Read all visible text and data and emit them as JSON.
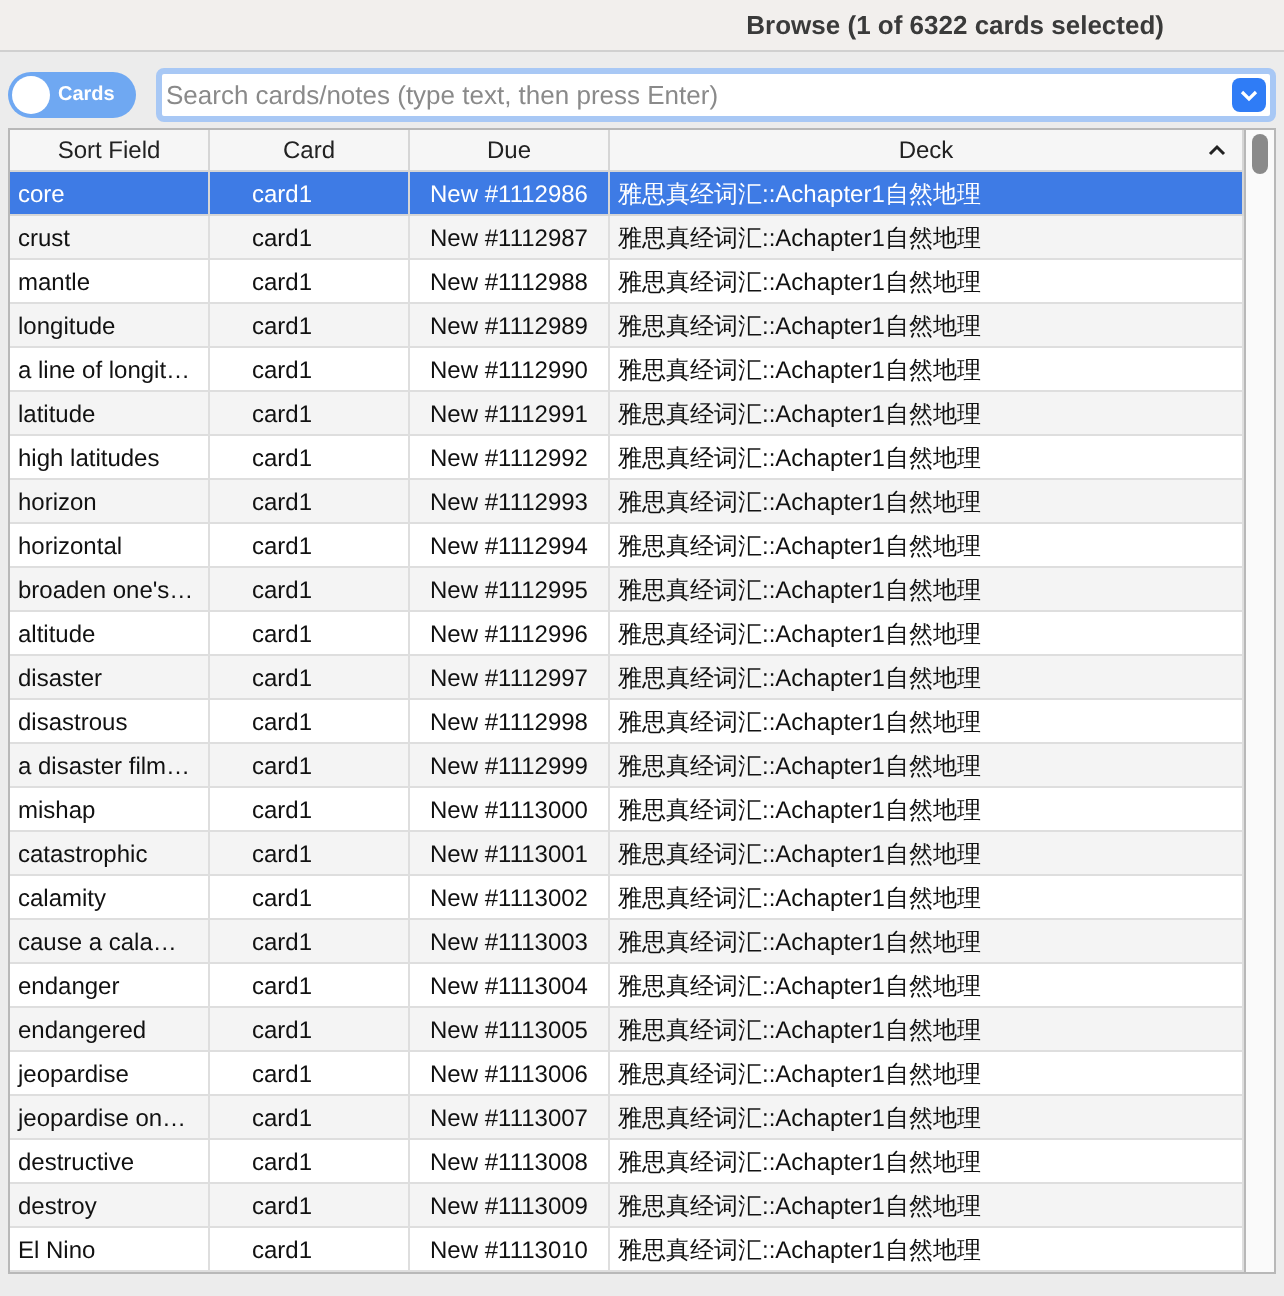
{
  "window": {
    "title": "Browse (1 of 6322 cards selected)"
  },
  "toggle": {
    "label": "Cards"
  },
  "search": {
    "placeholder": "Search cards/notes (type text, then press Enter)"
  },
  "table": {
    "columns": [
      {
        "label": "Sort Field",
        "sorted": false
      },
      {
        "label": "Card",
        "sorted": false
      },
      {
        "label": "Due",
        "sorted": false
      },
      {
        "label": "Deck",
        "sorted": true
      }
    ],
    "rows": [
      {
        "cells": [
          "core",
          "card1",
          "New #1112986",
          "雅思真经词汇::Achapter1自然地理"
        ],
        "selected": true
      },
      {
        "cells": [
          "crust",
          "card1",
          "New #1112987",
          "雅思真经词汇::Achapter1自然地理"
        ],
        "selected": false
      },
      {
        "cells": [
          "mantle",
          "card1",
          "New #1112988",
          "雅思真经词汇::Achapter1自然地理"
        ],
        "selected": false
      },
      {
        "cells": [
          "longitude",
          "card1",
          "New #1112989",
          "雅思真经词汇::Achapter1自然地理"
        ],
        "selected": false
      },
      {
        "cells": [
          "a line of longit…",
          "card1",
          "New #1112990",
          "雅思真经词汇::Achapter1自然地理"
        ],
        "selected": false
      },
      {
        "cells": [
          "latitude",
          "card1",
          "New #1112991",
          "雅思真经词汇::Achapter1自然地理"
        ],
        "selected": false
      },
      {
        "cells": [
          "high latitudes",
          "card1",
          "New #1112992",
          "雅思真经词汇::Achapter1自然地理"
        ],
        "selected": false
      },
      {
        "cells": [
          "horizon",
          "card1",
          "New #1112993",
          "雅思真经词汇::Achapter1自然地理"
        ],
        "selected": false
      },
      {
        "cells": [
          "horizontal",
          "card1",
          "New #1112994",
          "雅思真经词汇::Achapter1自然地理"
        ],
        "selected": false
      },
      {
        "cells": [
          "broaden one's…",
          "card1",
          "New #1112995",
          "雅思真经词汇::Achapter1自然地理"
        ],
        "selected": false
      },
      {
        "cells": [
          "altitude",
          "card1",
          "New #1112996",
          "雅思真经词汇::Achapter1自然地理"
        ],
        "selected": false
      },
      {
        "cells": [
          "disaster",
          "card1",
          "New #1112997",
          "雅思真经词汇::Achapter1自然地理"
        ],
        "selected": false
      },
      {
        "cells": [
          "disastrous",
          "card1",
          "New #1112998",
          "雅思真经词汇::Achapter1自然地理"
        ],
        "selected": false
      },
      {
        "cells": [
          "a disaster film…",
          "card1",
          "New #1112999",
          "雅思真经词汇::Achapter1自然地理"
        ],
        "selected": false
      },
      {
        "cells": [
          "mishap",
          "card1",
          "New #1113000",
          "雅思真经词汇::Achapter1自然地理"
        ],
        "selected": false
      },
      {
        "cells": [
          "catastrophic",
          "card1",
          "New #1113001",
          "雅思真经词汇::Achapter1自然地理"
        ],
        "selected": false
      },
      {
        "cells": [
          "calamity",
          "card1",
          "New #1113002",
          "雅思真经词汇::Achapter1自然地理"
        ],
        "selected": false
      },
      {
        "cells": [
          "cause a cala…",
          "card1",
          "New #1113003",
          "雅思真经词汇::Achapter1自然地理"
        ],
        "selected": false
      },
      {
        "cells": [
          "endanger",
          "card1",
          "New #1113004",
          "雅思真经词汇::Achapter1自然地理"
        ],
        "selected": false
      },
      {
        "cells": [
          "endangered",
          "card1",
          "New #1113005",
          "雅思真经词汇::Achapter1自然地理"
        ],
        "selected": false
      },
      {
        "cells": [
          "jeopardise",
          "card1",
          "New #1113006",
          "雅思真经词汇::Achapter1自然地理"
        ],
        "selected": false
      },
      {
        "cells": [
          "jeopardise on…",
          "card1",
          "New #1113007",
          "雅思真经词汇::Achapter1自然地理"
        ],
        "selected": false
      },
      {
        "cells": [
          "destructive",
          "card1",
          "New #1113008",
          "雅思真经词汇::Achapter1自然地理"
        ],
        "selected": false
      },
      {
        "cells": [
          "destroy",
          "card1",
          "New #1113009",
          "雅思真经词汇::Achapter1自然地理"
        ],
        "selected": false
      },
      {
        "cells": [
          "El Nino",
          "card1",
          "New #1113010",
          "雅思真经词汇::Achapter1自然地理"
        ],
        "selected": false
      }
    ]
  }
}
